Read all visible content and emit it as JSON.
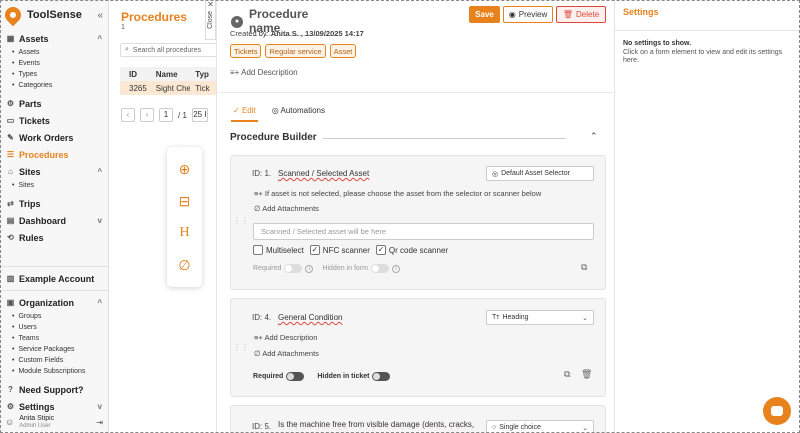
{
  "app": {
    "name": "ToolSense"
  },
  "sidebar": {
    "sections": [
      {
        "label": "Assets",
        "icon": "grid-icon",
        "items": [
          "Assets",
          "Events",
          "Types",
          "Categories"
        ]
      },
      {
        "label": "Parts",
        "icon": "parts-icon",
        "items": []
      },
      {
        "label": "Tickets",
        "icon": "ticket-icon",
        "items": []
      },
      {
        "label": "Work Orders",
        "icon": "work-orders-icon",
        "items": []
      },
      {
        "label": "Procedures",
        "icon": "procedures-icon",
        "items": []
      },
      {
        "label": "Sites",
        "icon": "sites-icon",
        "items": [
          "Sites"
        ]
      },
      {
        "label": "Trips",
        "icon": "trips-icon",
        "items": []
      },
      {
        "label": "Dashboard",
        "icon": "dashboard-icon",
        "items": []
      },
      {
        "label": "Rules",
        "icon": "rules-icon",
        "items": []
      }
    ],
    "account": "Example Account",
    "organization": {
      "label": "Organization",
      "items": [
        "Groups",
        "Users",
        "Teams",
        "Service Packages",
        "Custom Fields",
        "Module Subscriptions"
      ]
    },
    "support": "Need Support?",
    "settings": "Settings",
    "user": {
      "name": "Anita Stipic",
      "role": "Admin User"
    }
  },
  "list": {
    "title": "Procedures",
    "count": "1",
    "search_placeholder": "Search all procedures",
    "columns": [
      "ID",
      "Name",
      "Typ"
    ],
    "rows": [
      {
        "id": "3265",
        "name": "Sight Che",
        "type": "Tick"
      }
    ],
    "pager": {
      "page": "1",
      "of": "/ 1",
      "size": "25 I"
    }
  },
  "close_label": "Close",
  "procedure": {
    "name_placeholder": "Procedure name",
    "created_by_label": "Created by:",
    "created_by_value": "Anita S. , 13/09/2025 14:17",
    "tags": [
      "Tickets",
      "Regular service",
      "Asset"
    ],
    "add_description": "Add Description",
    "buttons": {
      "save": "Save",
      "preview": "Preview",
      "delete": "Delete"
    },
    "tabs": [
      {
        "label": "Edit",
        "active": true
      },
      {
        "label": "Automations",
        "active": false
      }
    ],
    "builder_title": "Procedure Builder",
    "questions": [
      {
        "id_label": "ID: 1.",
        "name": "Scanned / Selected Asset",
        "type": "Default Asset Selector",
        "description": "If asset is not selected, please choose the asset from the selector or scanner below",
        "add_attachments": "Add Attachments",
        "input_placeholder": "Scanned / Selected asset will be here",
        "checkboxes": [
          {
            "label": "Multiselect",
            "checked": false
          },
          {
            "label": "NFC scanner",
            "checked": true
          },
          {
            "label": "Qr code scanner",
            "checked": true
          }
        ],
        "required_label": "Required",
        "hidden_label": "Hidden in form"
      },
      {
        "id_label": "ID: 4.",
        "name": "General Condition",
        "type": "Heading",
        "add_description": "Add Description",
        "add_attachments": "Add Attachments",
        "required_label": "Required",
        "hidden_label": "Hidden in ticket"
      },
      {
        "id_label": "ID: 5.",
        "name": "Is the machine free from visible damage (dents, cracks,",
        "type": "Single choice"
      }
    ]
  },
  "settings_panel": {
    "title": "Settings",
    "empty": "No settings to show.",
    "hint": "Click on a form element to view and edit its settings here."
  },
  "colors": {
    "accent": "#e8821d",
    "danger": "#e0473b"
  }
}
